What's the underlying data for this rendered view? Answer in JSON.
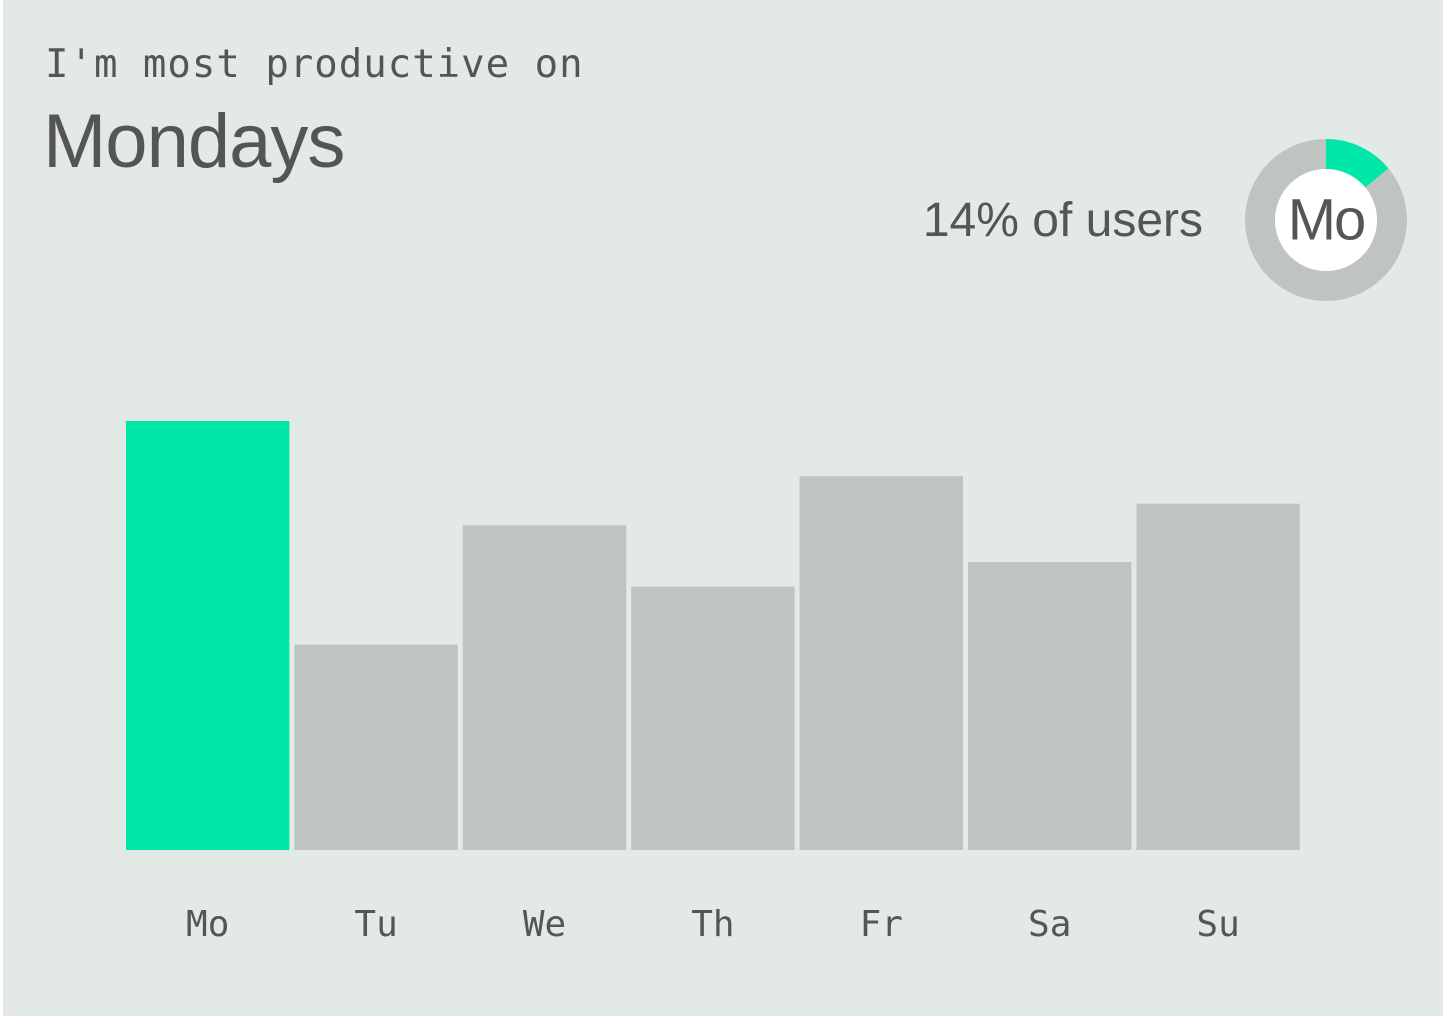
{
  "header": {
    "eyebrow": "I'm most productive on",
    "headline": "Mondays",
    "share_text": "14% of users"
  },
  "donut": {
    "label": "Mo",
    "fraction": 0.14,
    "colors": {
      "highlight": "#00e8a9",
      "track": "#bfc4c0",
      "center": "#ffffff",
      "label": "#555555"
    }
  },
  "colors": {
    "background": "#e3eae6",
    "text": "#555555",
    "highlight": "#00e8a9",
    "bar": "#bfc4c0"
  },
  "chart_data": {
    "type": "bar",
    "categories": [
      "Mo",
      "Tu",
      "We",
      "Th",
      "Fr",
      "Sa",
      "Su"
    ],
    "values": [
      14,
      6.7,
      10.6,
      8.6,
      12.2,
      9.4,
      11.3
    ],
    "highlight_index": 0,
    "title": "Mondays",
    "xlabel": "",
    "ylabel": "",
    "ylim": [
      0,
      14
    ],
    "grid": false,
    "legend": "none"
  }
}
